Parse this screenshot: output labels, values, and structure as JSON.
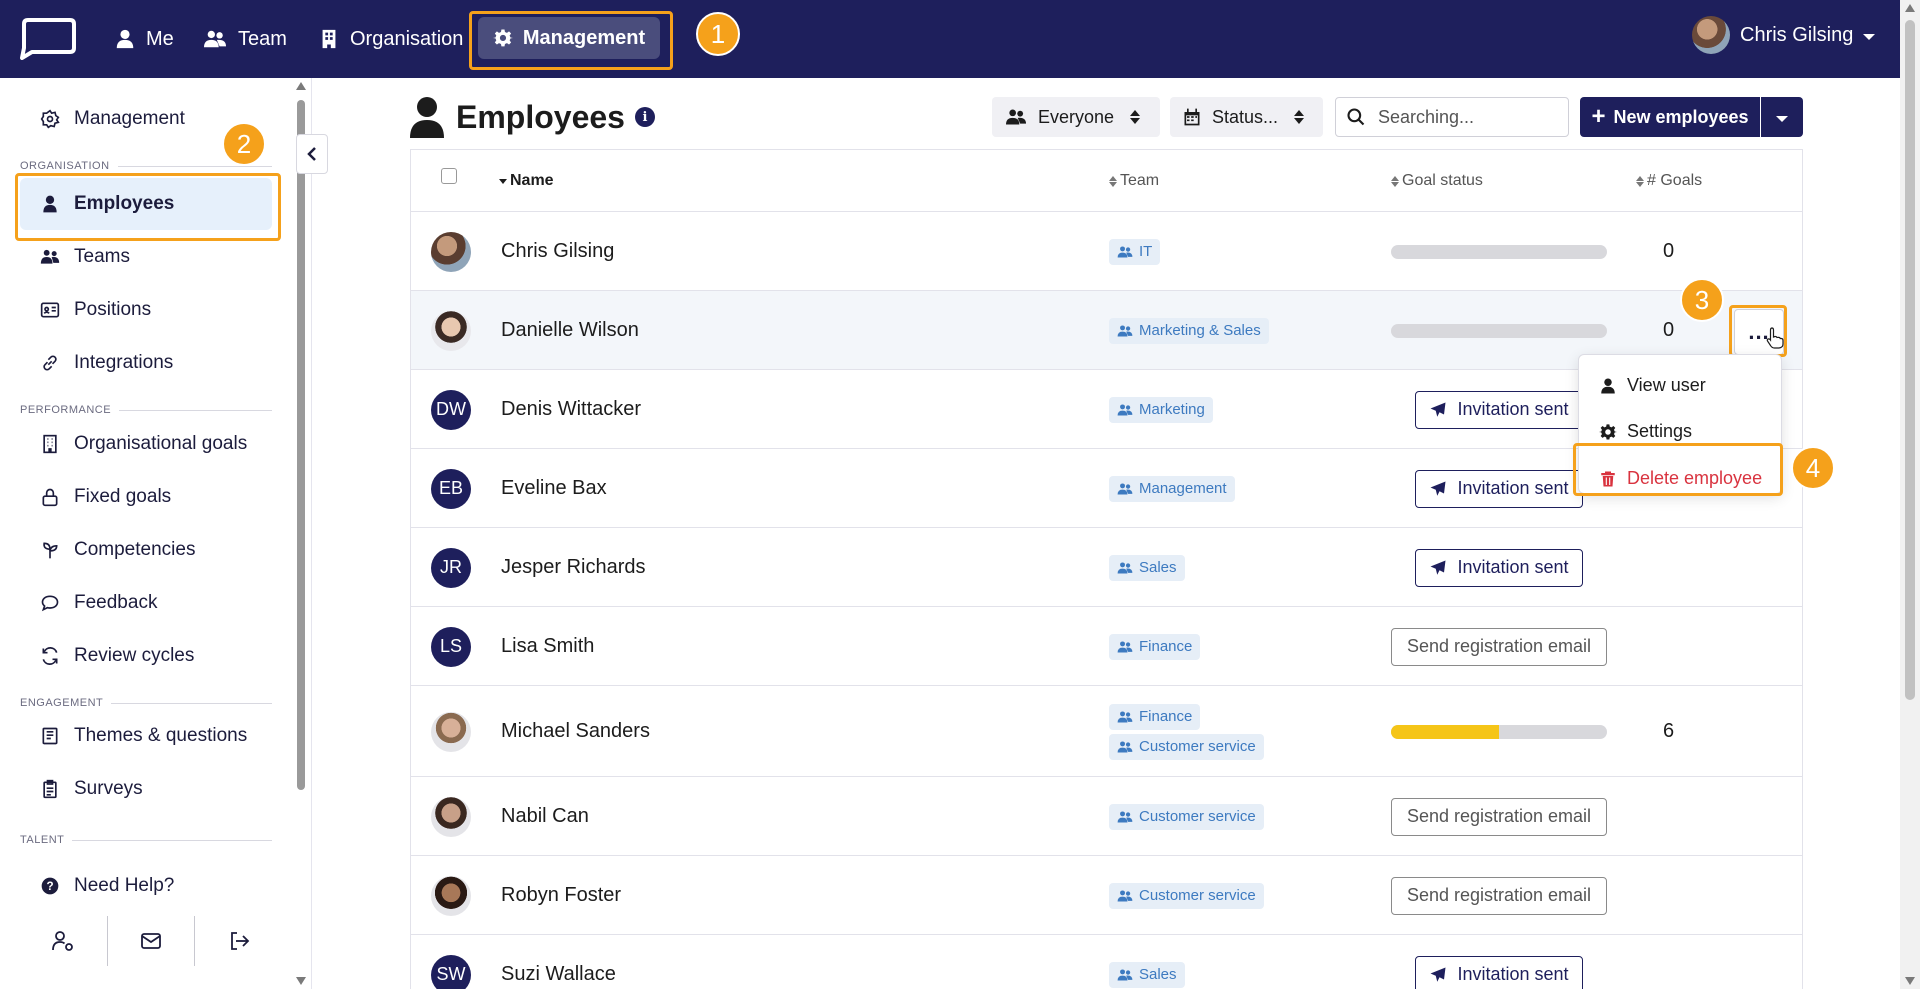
{
  "topbar": {
    "nav": [
      {
        "label": "Me",
        "icon": "user-icon"
      },
      {
        "label": "Team",
        "icon": "users-icon"
      },
      {
        "label": "Organisation",
        "icon": "building-icon"
      },
      {
        "label": "Management",
        "icon": "gear-icon"
      }
    ],
    "user_name": "Chris Gilsing"
  },
  "markers": [
    "1",
    "2",
    "3",
    "4"
  ],
  "sidebar": {
    "management_label": "Management",
    "sections": {
      "organisation": "ORGANISATION",
      "performance": "PERFORMANCE",
      "engagement": "ENGAGEMENT",
      "talent": "TALENT"
    },
    "items": {
      "employees": "Employees",
      "teams": "Teams",
      "positions": "Positions",
      "integrations": "Integrations",
      "org_goals": "Organisational goals",
      "fixed_goals": "Fixed goals",
      "competencies": "Competencies",
      "feedback": "Feedback",
      "review_cycles": "Review cycles",
      "themes": "Themes & questions",
      "surveys": "Surveys",
      "help": "Need Help?"
    }
  },
  "header": {
    "title": "Employees",
    "filter_everyone": "Everyone",
    "filter_status": "Status...",
    "search_placeholder": "Searching...",
    "new_button": "New employees"
  },
  "table": {
    "columns": {
      "name": "Name",
      "team": "Team",
      "goal_status": "Goal status",
      "goals": "# Goals"
    },
    "rows": [
      {
        "name": "Chris Gilsing",
        "initials": "",
        "teams": [
          "IT"
        ],
        "status": "progress",
        "progress": 0,
        "goals": "0"
      },
      {
        "name": "Danielle Wilson",
        "initials": "",
        "teams": [
          "Marketing & Sales"
        ],
        "status": "progress",
        "progress": 0,
        "goals": "0"
      },
      {
        "name": "Denis Wittacker",
        "initials": "DW",
        "teams": [
          "Marketing"
        ],
        "status": "Invitation sent",
        "goals": ""
      },
      {
        "name": "Eveline Bax",
        "initials": "EB",
        "teams": [
          "Management"
        ],
        "status": "Invitation sent",
        "goals": ""
      },
      {
        "name": "Jesper Richards",
        "initials": "JR",
        "teams": [
          "Sales"
        ],
        "status": "Invitation sent",
        "goals": ""
      },
      {
        "name": "Lisa Smith",
        "initials": "LS",
        "teams": [
          "Finance"
        ],
        "status": "Send registration email",
        "goals": ""
      },
      {
        "name": "Michael Sanders",
        "initials": "",
        "teams": [
          "Finance",
          "Customer service"
        ],
        "status": "progress",
        "progress": 0.5,
        "goals": "6"
      },
      {
        "name": "Nabil Can",
        "initials": "",
        "teams": [
          "Customer service"
        ],
        "status": "Send registration email",
        "goals": ""
      },
      {
        "name": "Robyn Foster",
        "initials": "",
        "teams": [
          "Customer service"
        ],
        "status": "Send registration email",
        "goals": ""
      },
      {
        "name": "Suzi Wallace",
        "initials": "SW",
        "teams": [
          "Sales"
        ],
        "status": "Invitation sent",
        "goals": ""
      }
    ]
  },
  "row_menu": {
    "trigger": "...",
    "items": {
      "view_user": "View user",
      "settings": "Settings",
      "delete": "Delete employee"
    }
  },
  "colors": {
    "nav_bg": "#1e1f5c",
    "accent": "#f5a11b",
    "danger": "#d9333f",
    "tag_text": "#3d7ac0",
    "progress_fill": "#f5c518"
  }
}
